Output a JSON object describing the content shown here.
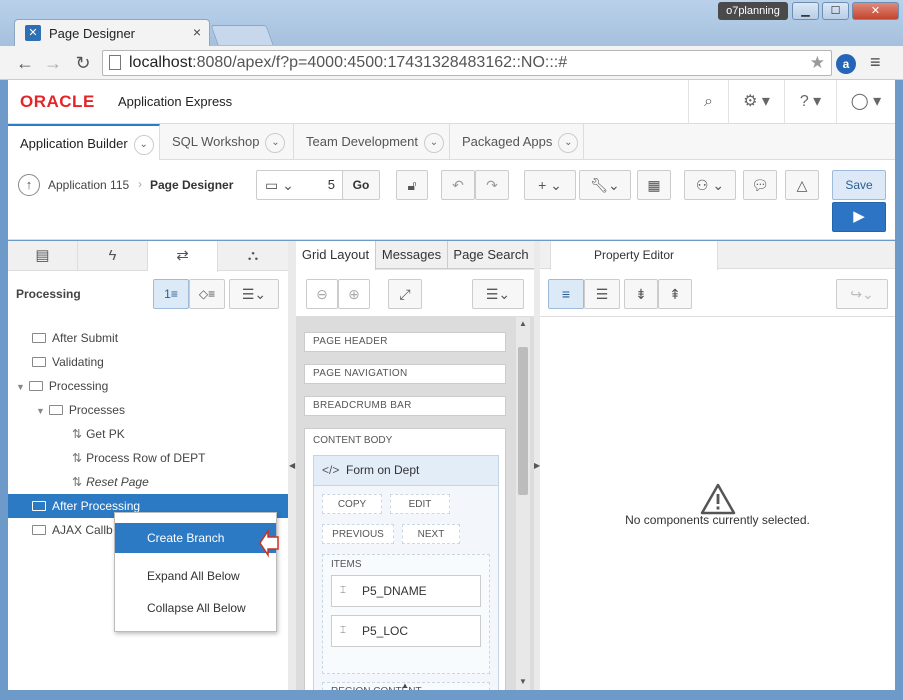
{
  "browser": {
    "tab_title": "Page Designer",
    "user": "o7planning",
    "url_host": "localhost",
    "url_rest": ":8080/apex/f?p=4000:4500:17431328483162::NO:::#"
  },
  "apex": {
    "logo": "ORACLE",
    "product": "Application Express",
    "nav_tabs": [
      "Application Builder",
      "SQL Workshop",
      "Team Development",
      "Packaged Apps"
    ]
  },
  "toolbar": {
    "app_crumb": "Application 115",
    "page_crumb": "Page Designer",
    "page_number": "5",
    "go_label": "Go",
    "save_label": "Save"
  },
  "left": {
    "title": "Processing",
    "tree": [
      {
        "label": "After Submit",
        "level": 0
      },
      {
        "label": "Validating",
        "level": 0
      },
      {
        "label": "Processing",
        "level": 0
      },
      {
        "label": "Processes",
        "level": 1
      },
      {
        "label": "Get PK",
        "level": 2
      },
      {
        "label": "Process Row of DEPT",
        "level": 2
      },
      {
        "label": "Reset Page",
        "level": 2
      },
      {
        "label": "After Processing",
        "level": 0
      },
      {
        "label": "AJAX Callb",
        "level": 0
      }
    ],
    "context_menu": [
      "Create Branch",
      "Expand All Below",
      "Collapse All Below"
    ]
  },
  "middle": {
    "tabs": [
      "Grid Layout",
      "Messages",
      "Page Search"
    ],
    "bars": [
      "PAGE HEADER",
      "PAGE NAVIGATION",
      "BREADCRUMB BAR"
    ],
    "content_body": "CONTENT BODY",
    "region_title": "Form on Dept",
    "buttons": [
      "COPY",
      "EDIT",
      "PREVIOUS",
      "NEXT"
    ],
    "items_label": "ITEMS",
    "items": [
      "P5_DNAME",
      "P5_LOC"
    ],
    "region_content": "REGION CONTENT"
  },
  "right": {
    "tab": "Property Editor",
    "empty_message": "No components currently selected."
  }
}
